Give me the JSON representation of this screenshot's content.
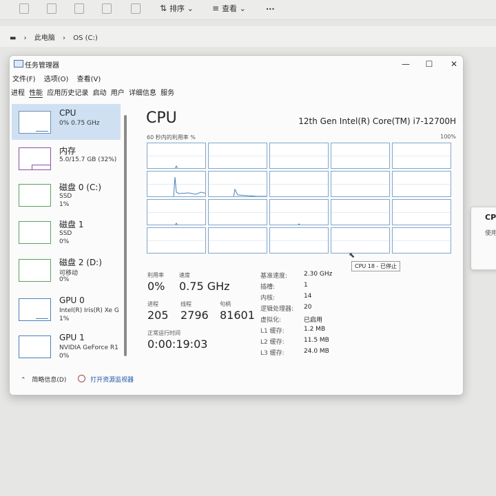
{
  "explorer": {
    "toolbar": {
      "sort_label": "排序",
      "view_label": "查看",
      "more_label": "..."
    },
    "breadcrumb": {
      "items": [
        "此电脑",
        "OS (C:)"
      ]
    }
  },
  "right_panel": {
    "title": "CPU",
    "subtitle": "使用"
  },
  "window": {
    "title": "任务管理器",
    "menu": [
      "文件(F)",
      "选项(O)",
      "查看(V)"
    ],
    "tabs": [
      "进程",
      "性能",
      "应用历史记录",
      "启动",
      "用户",
      "详细信息",
      "服务"
    ],
    "active_tab": "性能"
  },
  "sidebar": {
    "items": [
      {
        "name": "CPU",
        "line1": "0%  0.75 GHz",
        "line2": ""
      },
      {
        "name": "内存",
        "line1": "5.0/15.7 GB (32%)",
        "line2": ""
      },
      {
        "name": "磁盘 0 (C:)",
        "line1": "SSD",
        "line2": "1%"
      },
      {
        "name": "磁盘 1",
        "line1": "SSD",
        "line2": "0%"
      },
      {
        "name": "磁盘 2 (D:)",
        "line1": "可移动",
        "line2": "0%"
      },
      {
        "name": "GPU 0",
        "line1": "Intel(R) Iris(R) Xe G",
        "line2": "1%"
      },
      {
        "name": "GPU 1",
        "line1": "NVIDIA GeForce R1",
        "line2": "0%"
      }
    ]
  },
  "footer": {
    "summary_label": "简略信息(D)",
    "resource_monitor_label": "打开资源监视器"
  },
  "main": {
    "title": "CPU",
    "model": "12th Gen Intel(R) Core(TM) i7-12700H",
    "graph_caption": "60 秒内的利用率 %",
    "graph_max": "100%",
    "tooltip": "CPU 18 - 已停止",
    "stats": {
      "utilization_label": "利用率",
      "utilization": "0%",
      "speed_label": "速度",
      "speed": "0.75 GHz",
      "processes_label": "进程",
      "processes": "205",
      "threads_label": "线程",
      "threads": "2796",
      "handles_label": "句柄",
      "handles": "81601",
      "uptime_label": "正常运行时间",
      "uptime": "0:00:19:03"
    },
    "details": [
      {
        "k": "基准速度:",
        "v": "2.30 GHz"
      },
      {
        "k": "插槽:",
        "v": "1"
      },
      {
        "k": "内核:",
        "v": "14"
      },
      {
        "k": "逻辑处理器:",
        "v": "20"
      },
      {
        "k": "虚拟化:",
        "v": "已启用"
      },
      {
        "k": "L1 缓存:",
        "v": "1.2 MB"
      },
      {
        "k": "L2 缓存:",
        "v": "11.5 MB"
      },
      {
        "k": "L3 缓存:",
        "v": "24.0 MB"
      }
    ]
  },
  "colors": {
    "accent_cpu": "#4a7fb8",
    "memory": "#8a4fa1",
    "disk": "#58a15c",
    "selected_bg": "#cfe0f2"
  }
}
